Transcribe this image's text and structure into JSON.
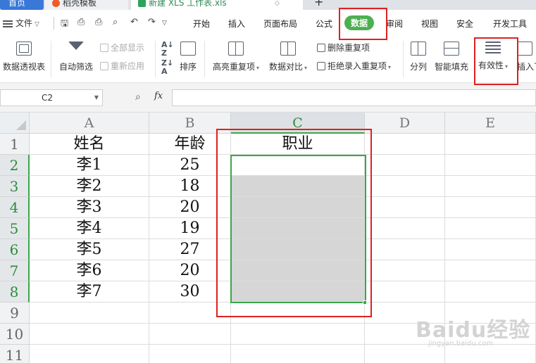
{
  "tabs": {
    "home": "首页",
    "template": "稻壳模板",
    "file": "新建 XLS 工作表.xls"
  },
  "menubar": {
    "file_label": "文件",
    "tabs": [
      "开始",
      "插入",
      "页面布局",
      "公式",
      "数据",
      "审阅",
      "视图",
      "安全",
      "开发工具"
    ],
    "active_tab": "数据"
  },
  "ribbon": {
    "pivot": "数据透视表",
    "autofilter": "自动筛选",
    "show_all": "全部显示",
    "reapply": "重新应用",
    "sort": "排序",
    "highlight_dup": "高亮重复项",
    "compare": "数据对比",
    "remove_dup": "删除重复项",
    "reject_dup": "拒绝录入重复项",
    "split": "分列",
    "smart_fill": "智能填充",
    "validity": "有效性",
    "insert": "插入下"
  },
  "formula_bar": {
    "name_box": "C2",
    "fx": "fx",
    "value": ""
  },
  "sheet": {
    "columns": [
      "A",
      "B",
      "C",
      "D",
      "E"
    ],
    "rows": [
      "1",
      "2",
      "3",
      "4",
      "5",
      "6",
      "7",
      "8",
      "9",
      "10",
      "11"
    ],
    "selected_column": "C",
    "active_cell": "C2",
    "data": [
      [
        "姓名",
        "年龄",
        "职业"
      ],
      [
        "李1",
        "25",
        ""
      ],
      [
        "李2",
        "18",
        ""
      ],
      [
        "李3",
        "20",
        ""
      ],
      [
        "李4",
        "19",
        ""
      ],
      [
        "李5",
        "27",
        ""
      ],
      [
        "李6",
        "20",
        ""
      ],
      [
        "李7",
        "30",
        ""
      ]
    ]
  },
  "watermark": {
    "brand": "Baidu经验",
    "url": "jingyan.baidu.com"
  },
  "colors": {
    "accent_green": "#4caf50",
    "selection_green": "#3aa64a",
    "annotation_red": "#e02020",
    "home_tab_blue": "#3a78d8"
  }
}
